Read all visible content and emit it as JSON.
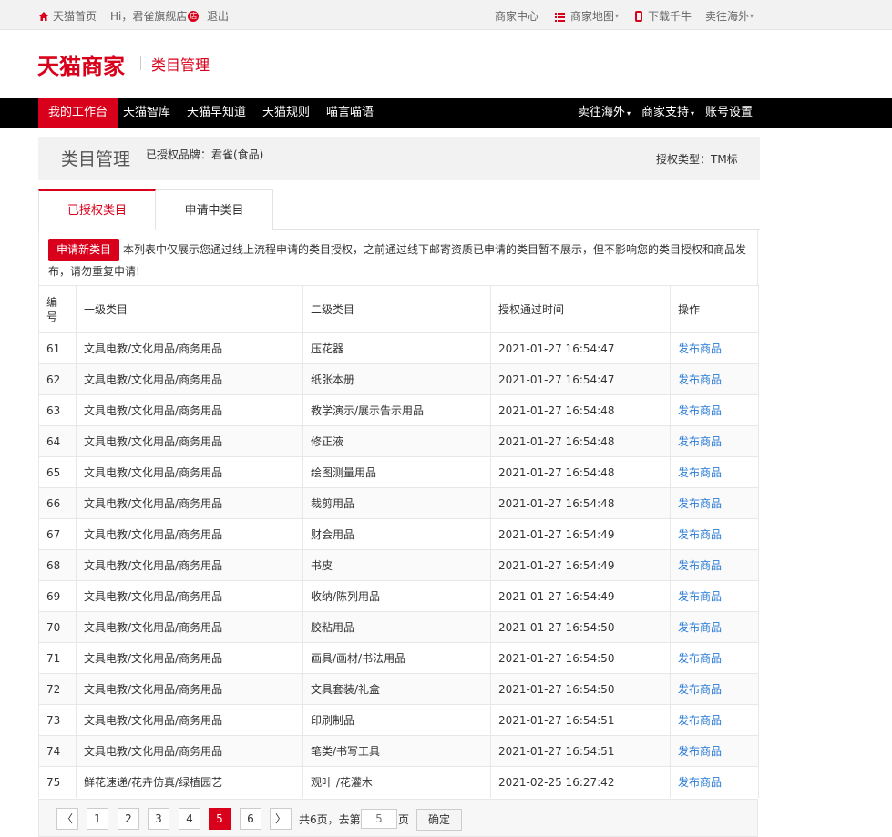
{
  "topbar": {
    "home": "天猫首页",
    "greeting": "Hi，君雀旗舰店",
    "badge": "店",
    "logout": "退出",
    "merchant_center": "商家中心",
    "merchant_map": "商家地图",
    "download": "下载千牛",
    "overseas": "卖往海外"
  },
  "header": {
    "logo": "天猫商家",
    "subtitle": "类目管理"
  },
  "nav": {
    "items": [
      "我的工作台",
      "天猫智库",
      "天猫早知道",
      "天猫规则",
      "喵言喵语"
    ],
    "right": [
      "卖往海外",
      "商家支持",
      "账号设置"
    ]
  },
  "titlebar": {
    "title": "类目管理",
    "brand": "已授权品牌：君雀(食品)",
    "auth_type": "授权类型：TM标"
  },
  "tabs": [
    "已授权类目",
    "申请中类目"
  ],
  "notice": {
    "button": "申请新类目",
    "text": "本列表中仅展示您通过线上流程申请的类目授权，之前通过线下邮寄资质已申请的类目暂不展示，但不影响您的类目授权和商品发布，请勿重复申请!"
  },
  "table": {
    "headers": [
      "编号",
      "一级类目",
      "二级类目",
      "授权通过时间",
      "操作"
    ],
    "rows": [
      [
        "61",
        "文具电教/文化用品/商务用品",
        "压花器",
        "2021-01-27 16:54:47",
        "发布商品"
      ],
      [
        "62",
        "文具电教/文化用品/商务用品",
        "纸张本册",
        "2021-01-27 16:54:47",
        "发布商品"
      ],
      [
        "63",
        "文具电教/文化用品/商务用品",
        "教学演示/展示告示用品",
        "2021-01-27 16:54:48",
        "发布商品"
      ],
      [
        "64",
        "文具电教/文化用品/商务用品",
        "修正液",
        "2021-01-27 16:54:48",
        "发布商品"
      ],
      [
        "65",
        "文具电教/文化用品/商务用品",
        "绘图测量用品",
        "2021-01-27 16:54:48",
        "发布商品"
      ],
      [
        "66",
        "文具电教/文化用品/商务用品",
        "裁剪用品",
        "2021-01-27 16:54:48",
        "发布商品"
      ],
      [
        "67",
        "文具电教/文化用品/商务用品",
        "财会用品",
        "2021-01-27 16:54:49",
        "发布商品"
      ],
      [
        "68",
        "文具电教/文化用品/商务用品",
        "书皮",
        "2021-01-27 16:54:49",
        "发布商品"
      ],
      [
        "69",
        "文具电教/文化用品/商务用品",
        "收纳/陈列用品",
        "2021-01-27 16:54:49",
        "发布商品"
      ],
      [
        "70",
        "文具电教/文化用品/商务用品",
        "胶粘用品",
        "2021-01-27 16:54:50",
        "发布商品"
      ],
      [
        "71",
        "文具电教/文化用品/商务用品",
        "画具/画材/书法用品",
        "2021-01-27 16:54:50",
        "发布商品"
      ],
      [
        "72",
        "文具电教/文化用品/商务用品",
        "文具套装/礼盒",
        "2021-01-27 16:54:50",
        "发布商品"
      ],
      [
        "73",
        "文具电教/文化用品/商务用品",
        "印刷制品",
        "2021-01-27 16:54:51",
        "发布商品"
      ],
      [
        "74",
        "文具电教/文化用品/商务用品",
        "笔类/书写工具",
        "2021-01-27 16:54:51",
        "发布商品"
      ],
      [
        "75",
        "鲜花速递/花卉仿真/绿植园艺",
        "观叶 /花灌木",
        "2021-02-25 16:27:42",
        "发布商品"
      ]
    ]
  },
  "pager": {
    "prev": "〈",
    "pages": [
      "1",
      "2",
      "3",
      "4",
      "5",
      "6"
    ],
    "current": "5",
    "next": "〉",
    "total": "共6页，去第",
    "input_placeholder": "5",
    "unit": "页",
    "confirm": "确定"
  },
  "colors": {
    "brand_red": "#d9001b",
    "link_blue": "#2a7bd5"
  }
}
